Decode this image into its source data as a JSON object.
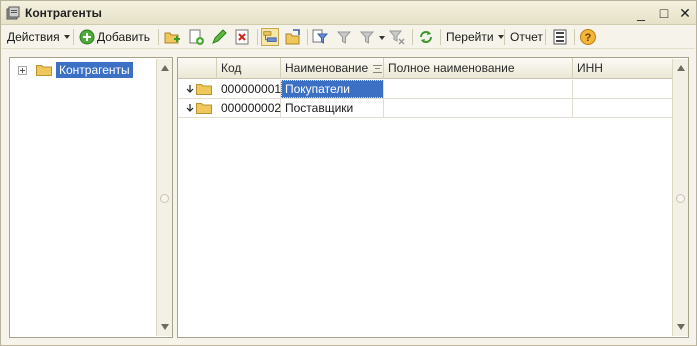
{
  "window": {
    "title": "Контрагенты",
    "buttons": {
      "minimize": "_",
      "maximize": "□",
      "close": "✕"
    }
  },
  "toolbar": {
    "actions_label": "Действия",
    "add_label": "Добавить",
    "goto_label": "Перейти",
    "report_label": "Отчет",
    "icons": [
      "add-group-icon",
      "copy-icon",
      "edit-icon",
      "delete-icon",
      "hierarchy-icon",
      "move-to-group-icon",
      "filter-icon",
      "filter-by-value-icon",
      "filter-history-icon",
      "clear-filter-icon",
      "refresh-icon",
      "list-settings-icon",
      "help-icon"
    ]
  },
  "tree": {
    "root_label": "Контрагенты"
  },
  "table": {
    "columns": [
      "Код",
      "Наименование",
      "Полное наименование",
      "ИНН"
    ],
    "rows": [
      {
        "code": "000000001",
        "name": "Покупатели",
        "full_name": "",
        "inn": ""
      },
      {
        "code": "000000002",
        "name": "Поставщики",
        "full_name": "",
        "inn": ""
      }
    ]
  },
  "colors": {
    "selection": "#3b70c5",
    "folder": "#f0c75a",
    "window_bg": "#f6f4ea"
  }
}
